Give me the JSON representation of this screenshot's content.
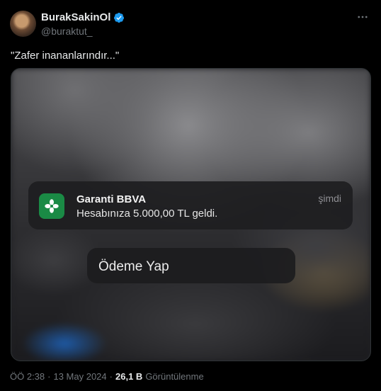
{
  "author": {
    "name": "BurakSakinOl",
    "handle": "@buraktut_",
    "verified": true
  },
  "tweet": {
    "text": "\"Zafer inananlarındır...\""
  },
  "media": {
    "notification": {
      "app_name": "Garanti BBVA",
      "message": "Hesabınıza 5.000,00 TL geldi.",
      "time": "şimdi",
      "app_color": "#1a8a45"
    },
    "action": {
      "label": "Ödeme Yap"
    }
  },
  "meta": {
    "time": "ÖÖ 2:38",
    "separator": "·",
    "date": "13 May 2024",
    "views_count": "26,1 B",
    "views_label": "Görüntülenme"
  },
  "colors": {
    "verified": "#1d9bf0",
    "muted": "#71767b"
  }
}
